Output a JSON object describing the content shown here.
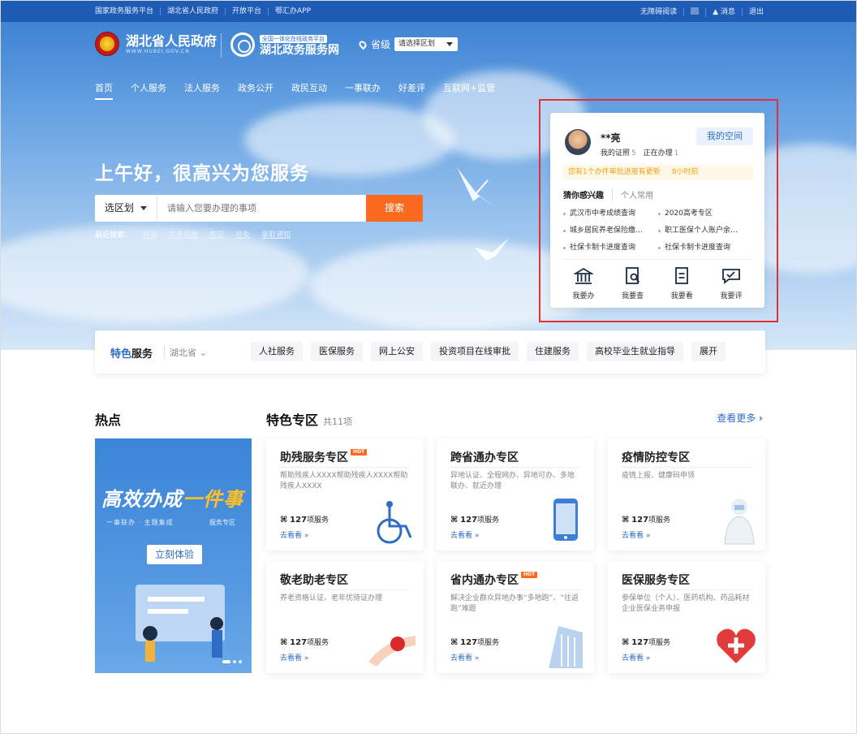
{
  "topbar": {
    "left_links": [
      "国家政务服务平台",
      "湖北省人民政府",
      "开放平台",
      "鄂汇办APP"
    ],
    "accessibility": "无障碍阅读",
    "messages": "消息",
    "logout": "退出"
  },
  "header": {
    "gov_name": "湖北省人民政府",
    "gov_url": "WWW.HUBEI.GOV.CN",
    "portal_tag": "全国一体化在线政务平台",
    "portal_name": "湖北政务服务网",
    "region_level": "省级",
    "region_select": "请选择区划"
  },
  "nav": {
    "items": [
      "首页",
      "个人服务",
      "法人服务",
      "政务公开",
      "政民互动",
      "一事联办",
      "好差评",
      "互联网+监管"
    ],
    "active": "首页"
  },
  "hero": {
    "greeting": "上午好，很高兴为您服务",
    "search": {
      "region": "选区划",
      "placeholder": "请输入您要办理的事项",
      "button": "搜索"
    },
    "recent_label": "最近搜索：",
    "recent": [
      "社保",
      "高考成绩",
      "签证",
      "挂失",
      "录取通知"
    ]
  },
  "user_card": {
    "name": "**亮",
    "my_space": "我的空间",
    "cert_label": "我的证照",
    "cert_count": "5",
    "doing_label": "正在办理",
    "doing_count": "1",
    "notice": "您有1个办件审批进度有更新",
    "notice_time": "8小时前",
    "tab_active": "猜你感兴趣",
    "tab_other": "个人常用",
    "items": [
      "武汉市中考成绩查询",
      "2020高考专区",
      "城乡居民养老保险缴…",
      "职工医保个人账户余…",
      "社保卡制卡进度查询",
      "社保卡制卡进度查询"
    ],
    "actions": [
      {
        "label": "我要办",
        "icon": "bank-icon"
      },
      {
        "label": "我要查",
        "icon": "doc-search-icon"
      },
      {
        "label": "我要看",
        "icon": "doc-view-icon"
      },
      {
        "label": "我要评",
        "icon": "chat-icon"
      }
    ]
  },
  "feature_band": {
    "title_a": "特色",
    "title_b": "服务",
    "region": "湖北省",
    "tags": [
      "人社服务",
      "医保服务",
      "网上公安",
      "投资项目在线审批",
      "住建服务",
      "高校毕业生就业指导",
      "展开"
    ]
  },
  "hot": {
    "title": "热点",
    "banner_title_a": "高效办成",
    "banner_title_b": "一件事",
    "banner_sub": "一事联办 · 主题集成",
    "banner_sub2": "服务专区",
    "banner_button": "立刻体验"
  },
  "zones": {
    "title": "特色专区",
    "count": "共11项",
    "more": "查看更多",
    "hot_badge": "HOT",
    "count_unit": "项服务",
    "link": "去看看",
    "cards": [
      {
        "title": "助残服务专区",
        "hot": true,
        "desc": "帮助残疾人XXXX帮助残疾人XXXX帮助残疾人XXXX",
        "count": "127"
      },
      {
        "title": "跨省通办专区",
        "hot": false,
        "desc": "异地认证、全程网办、异地可办、多地联办、就近办理",
        "count": "127"
      },
      {
        "title": "疫情防控专区",
        "hot": false,
        "desc": "疫情上报、健康码申领",
        "count": "127"
      },
      {
        "title": "敬老助老专区",
        "hot": false,
        "desc": "养老资格认证、老年优待证办理",
        "count": "127"
      },
      {
        "title": "省内通办专区",
        "hot": true,
        "desc": "解决企业群众异地办事“多地跑”、“往返跑”难题",
        "count": "127"
      },
      {
        "title": "医保服务专区",
        "hot": false,
        "desc": "参保单位（个人）、医药机构、药品耗材企业医保业务申报",
        "count": "127"
      }
    ]
  }
}
